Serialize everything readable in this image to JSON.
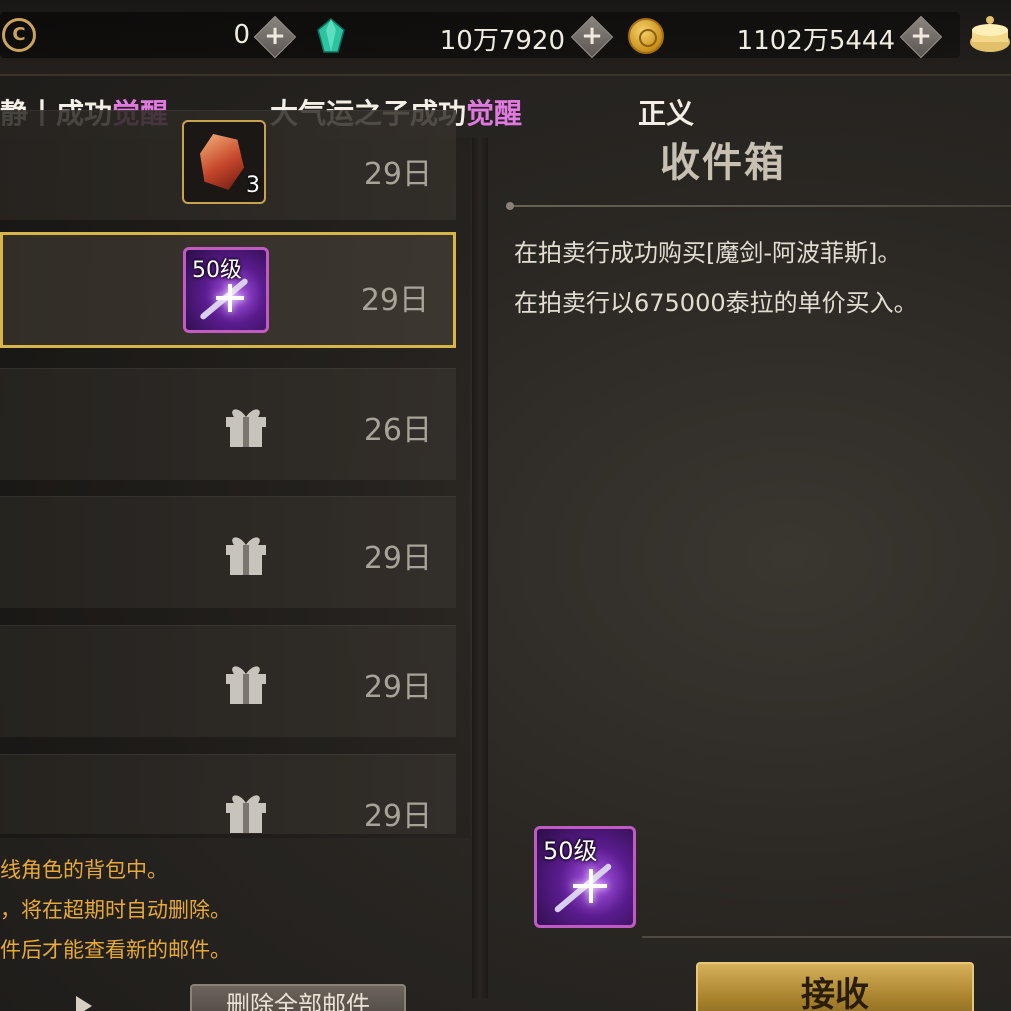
{
  "topbar": {
    "resource1_value": "0",
    "resource2_value": "10万7920",
    "resource3_value": "1102万5444",
    "plus_label": "+",
    "logo_glyph": "C"
  },
  "ticker": {
    "seg1_text": "静丨成功",
    "seg1_highlight": "觉醒",
    "seg2_text": "大气运之子成功",
    "seg2_highlight": "觉醒",
    "seg3_text": "正义"
  },
  "mail": {
    "items": [
      {
        "date": "29日",
        "attachment": "ore-stack",
        "count": "3"
      },
      {
        "date": "29日",
        "attachment": "sword-item",
        "level": "50级"
      },
      {
        "date": "26日",
        "attachment": "gift-icon"
      },
      {
        "date": "29日",
        "attachment": "gift-icon"
      },
      {
        "date": "29日",
        "attachment": "gift-icon"
      },
      {
        "date": "29日",
        "attachment": "gift-icon"
      }
    ]
  },
  "notice": {
    "line1": "线角色的背包中。",
    "line2": "，将在超期时自动删除。",
    "line3": "件后才能查看新的邮件。"
  },
  "detail": {
    "title": "收件箱",
    "line1": "在拍卖行成功购买[魔剑-阿波菲斯]。",
    "line2": "在拍卖行以675000泰拉的单价买入。",
    "item_level": "50级"
  },
  "buttons": {
    "delete_label": "删除全部邮件",
    "receive_label": "接收"
  },
  "colors": {
    "accent_gold": "#d8b54a",
    "highlight_purple": "#e07ae0",
    "notice_orange": "#e6a93a"
  }
}
